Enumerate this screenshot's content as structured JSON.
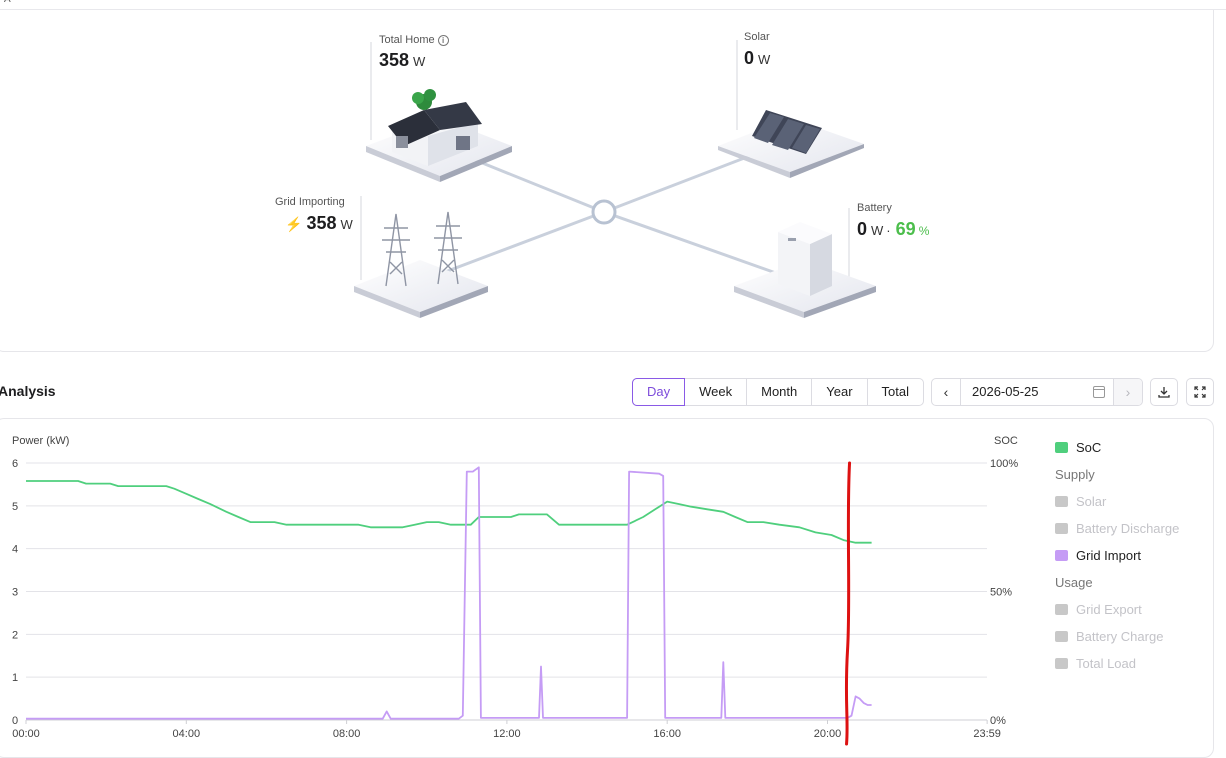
{
  "top_glyph": "A",
  "energy_flow": {
    "total_home": {
      "label": "Total Home",
      "value": "358",
      "unit": "W",
      "info_icon": "info-icon"
    },
    "solar": {
      "label": "Solar",
      "value": "0",
      "unit": "W"
    },
    "grid": {
      "label": "Grid Importing",
      "value": "358",
      "unit": "W",
      "icon": "transmission-tower-icon"
    },
    "battery": {
      "label": "Battery",
      "value": "0",
      "unit": "W",
      "separator": "·",
      "soc": "69",
      "soc_unit": "%"
    }
  },
  "analysis": {
    "title": "Analysis",
    "tabs": [
      {
        "label": "Day",
        "active": true
      },
      {
        "label": "Week",
        "active": false
      },
      {
        "label": "Month",
        "active": false
      },
      {
        "label": "Year",
        "active": false
      },
      {
        "label": "Total",
        "active": false
      }
    ],
    "prev_icon": "‹",
    "next_icon": "›",
    "date": "2026-05-25",
    "download_icon": "download-icon",
    "fullscreen_icon": "fullscreen-icon"
  },
  "legend": {
    "items": [
      {
        "kind": "item",
        "label": "SoC",
        "color": "#4fcf7d",
        "active": true
      },
      {
        "kind": "heading",
        "label": "Supply"
      },
      {
        "kind": "item",
        "label": "Solar",
        "color": "#c8c8c8",
        "active": false
      },
      {
        "kind": "item",
        "label": "Battery Discharge",
        "color": "#c8c8c8",
        "active": false
      },
      {
        "kind": "item",
        "label": "Grid Import",
        "color": "#c59cf5",
        "active": true
      },
      {
        "kind": "heading",
        "label": "Usage"
      },
      {
        "kind": "item",
        "label": "Grid Export",
        "color": "#c8c8c8",
        "active": false
      },
      {
        "kind": "item",
        "label": "Battery Charge",
        "color": "#c8c8c8",
        "active": false
      },
      {
        "kind": "item",
        "label": "Total Load",
        "color": "#c8c8c8",
        "active": false
      }
    ]
  },
  "chart_data": {
    "type": "line",
    "ylabel": "Power (kW)",
    "y2label": "SOC",
    "ylim": [
      0,
      6
    ],
    "y_ticks": [
      "0",
      "1",
      "2",
      "3",
      "4",
      "5",
      "6"
    ],
    "y2lim": [
      0,
      100
    ],
    "y2_ticks": [
      "0%",
      "50%",
      "100%"
    ],
    "x_range_hours": [
      0,
      23.98
    ],
    "x_ticks": [
      "00:00",
      "04:00",
      "08:00",
      "12:00",
      "16:00",
      "20:00",
      "23:59"
    ],
    "grid": true,
    "series": [
      {
        "name": "SoC",
        "axis": "right",
        "color": "#4fcf7d",
        "points": [
          [
            0,
            93
          ],
          [
            1.3,
            93
          ],
          [
            1.5,
            92
          ],
          [
            2.1,
            92
          ],
          [
            2.3,
            91
          ],
          [
            3.5,
            91
          ],
          [
            3.7,
            90
          ],
          [
            4.0,
            88
          ],
          [
            4.3,
            86
          ],
          [
            4.6,
            84
          ],
          [
            5.0,
            81
          ],
          [
            5.3,
            79
          ],
          [
            5.6,
            77
          ],
          [
            6.2,
            77
          ],
          [
            6.5,
            76
          ],
          [
            8.3,
            76
          ],
          [
            8.6,
            75
          ],
          [
            9.4,
            75
          ],
          [
            9.7,
            76
          ],
          [
            10.0,
            77
          ],
          [
            10.3,
            77
          ],
          [
            10.6,
            76
          ],
          [
            11.1,
            76
          ],
          [
            11.3,
            79
          ],
          [
            12.1,
            79
          ],
          [
            12.3,
            80
          ],
          [
            13.0,
            80
          ],
          [
            13.3,
            76
          ],
          [
            15.0,
            76
          ],
          [
            15.4,
            79
          ],
          [
            15.7,
            82
          ],
          [
            16.0,
            85
          ],
          [
            16.3,
            84
          ],
          [
            16.6,
            83
          ],
          [
            17.0,
            82
          ],
          [
            17.4,
            81
          ],
          [
            17.7,
            79
          ],
          [
            18.0,
            77
          ],
          [
            18.4,
            77
          ],
          [
            18.8,
            76
          ],
          [
            19.3,
            75
          ],
          [
            19.7,
            73
          ],
          [
            20.1,
            72
          ],
          [
            20.4,
            70
          ],
          [
            20.7,
            69
          ],
          [
            21.1,
            69
          ]
        ]
      },
      {
        "name": "Grid Import",
        "axis": "left",
        "color": "#c59cf5",
        "points": [
          [
            0,
            0.03
          ],
          [
            8.9,
            0.03
          ],
          [
            9.0,
            0.2
          ],
          [
            9.1,
            0.03
          ],
          [
            10.8,
            0.03
          ],
          [
            10.9,
            0.1
          ],
          [
            11.0,
            5.8
          ],
          [
            11.15,
            5.8
          ],
          [
            11.3,
            5.9
          ],
          [
            11.35,
            0.05
          ],
          [
            12.8,
            0.05
          ],
          [
            12.85,
            1.25
          ],
          [
            12.9,
            0.05
          ],
          [
            15.0,
            0.05
          ],
          [
            15.05,
            5.8
          ],
          [
            15.8,
            5.75
          ],
          [
            15.9,
            5.7
          ],
          [
            15.95,
            0.05
          ],
          [
            17.35,
            0.05
          ],
          [
            17.4,
            1.35
          ],
          [
            17.45,
            0.05
          ],
          [
            20.5,
            0.05
          ],
          [
            20.6,
            0.1
          ],
          [
            20.7,
            0.55
          ],
          [
            20.8,
            0.5
          ],
          [
            20.9,
            0.4
          ],
          [
            21.0,
            0.35
          ],
          [
            21.1,
            0.35
          ]
        ]
      }
    ],
    "annotation": {
      "type": "freehand-marker",
      "color": "#dd1111",
      "at_hour": 20.5
    }
  }
}
